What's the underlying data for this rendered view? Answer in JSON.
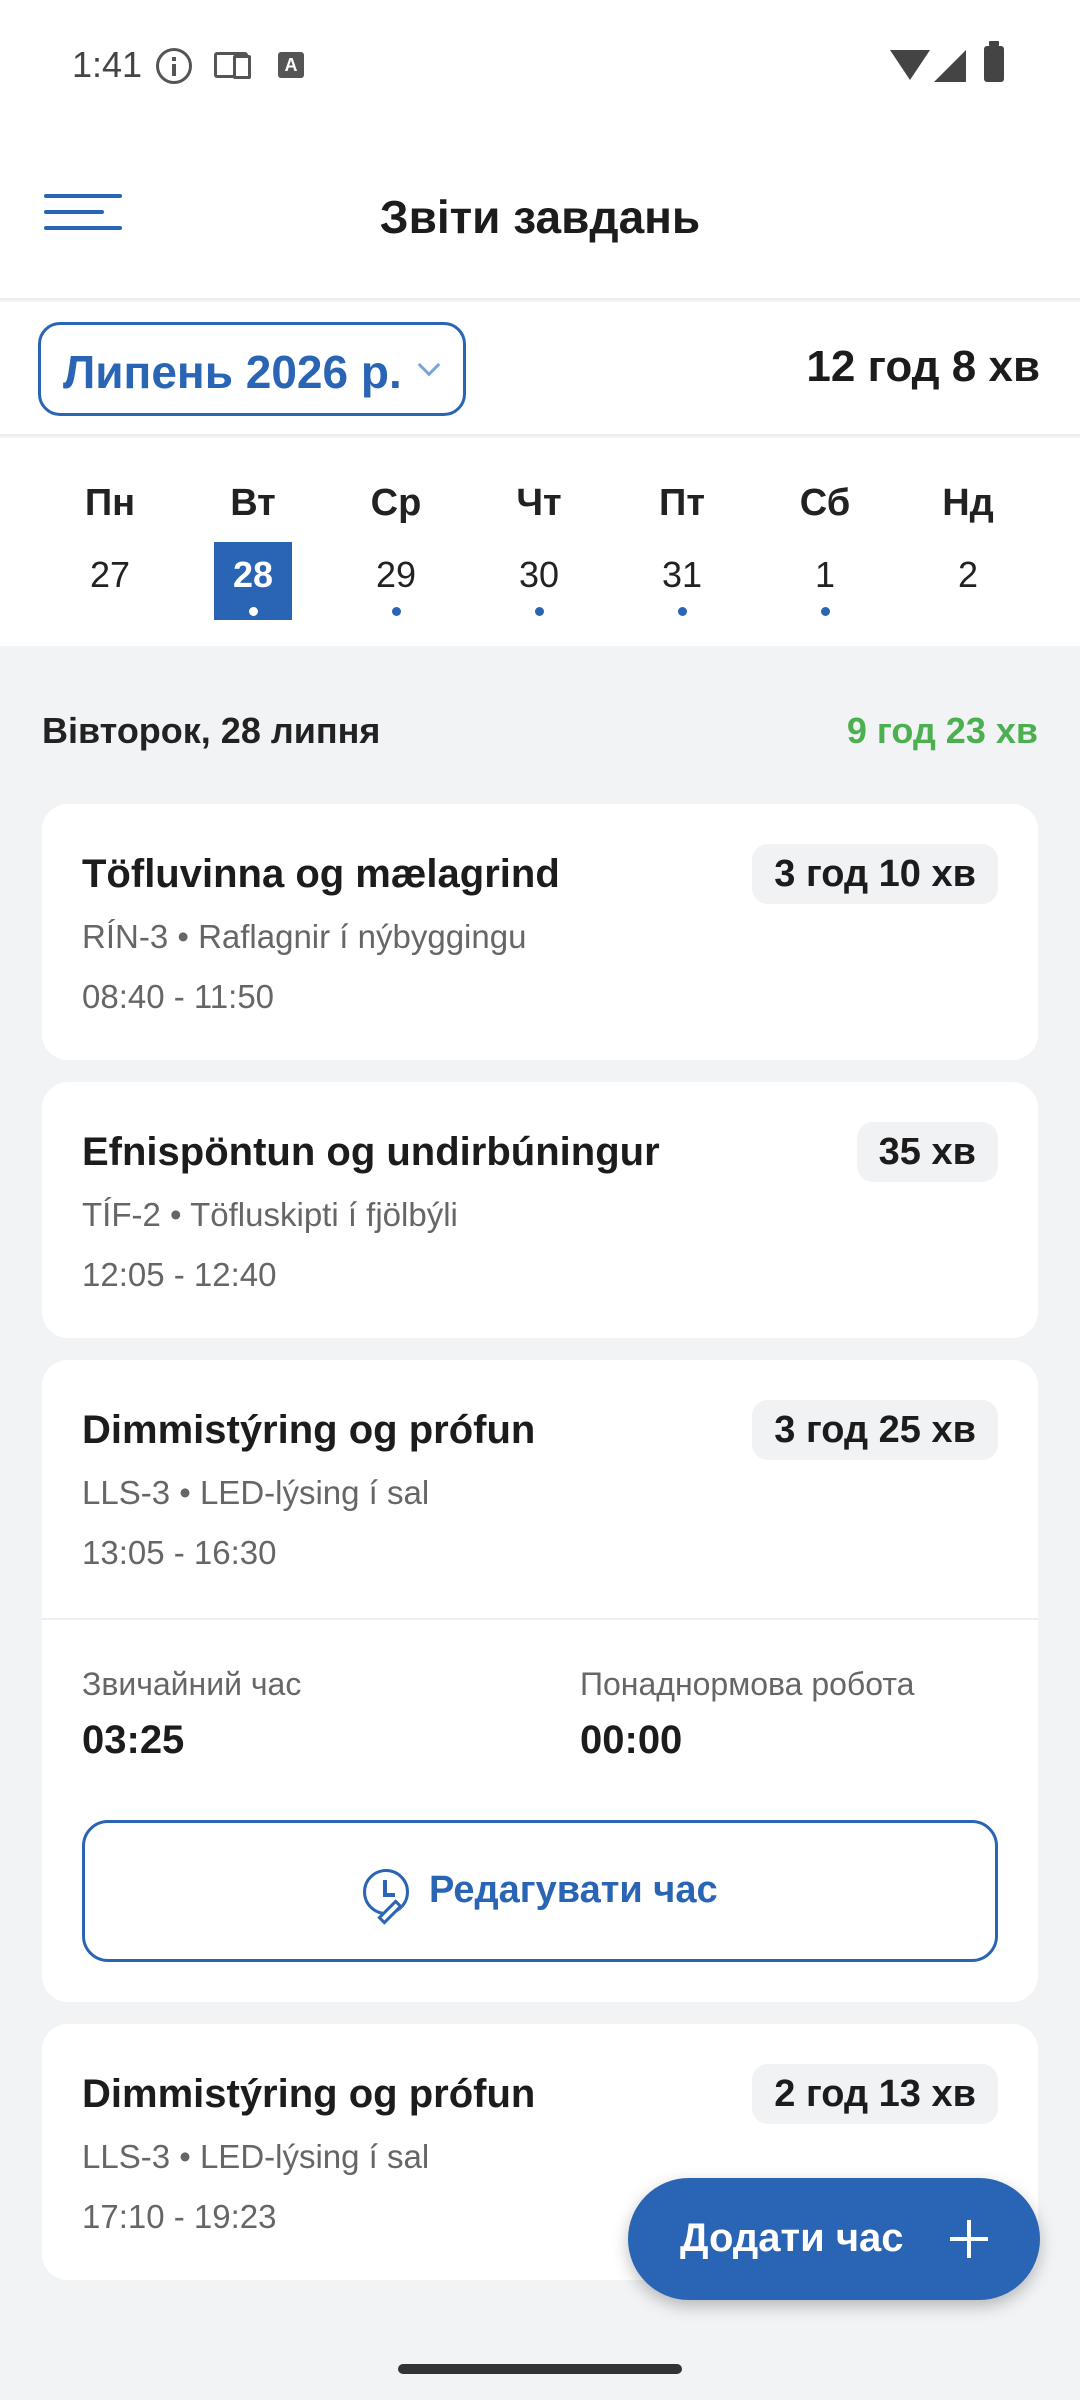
{
  "status_bar": {
    "time": "1:41"
  },
  "app_bar": {
    "title": "Звіти завдань"
  },
  "month_row": {
    "month_label": "Липень 2026 р.",
    "total": "12 год 8 хв"
  },
  "week": [
    {
      "name": "Пн",
      "num": "27",
      "selected": false,
      "has_entries": false
    },
    {
      "name": "Вт",
      "num": "28",
      "selected": true,
      "has_entries": true
    },
    {
      "name": "Ср",
      "num": "29",
      "selected": false,
      "has_entries": true
    },
    {
      "name": "Чт",
      "num": "30",
      "selected": false,
      "has_entries": true
    },
    {
      "name": "Пт",
      "num": "31",
      "selected": false,
      "has_entries": true
    },
    {
      "name": "Сб",
      "num": "1",
      "selected": false,
      "has_entries": true
    },
    {
      "name": "Нд",
      "num": "2",
      "selected": false,
      "has_entries": false
    }
  ],
  "day_header": {
    "date": "Вівторок, 28 липня",
    "total": "9 год 23 хв"
  },
  "entries": [
    {
      "title": "Töfluvinna og mælagrind",
      "duration": "3 год 10 хв",
      "subtitle": "RÍN-3 • Raflagnir í nýbyggingu",
      "time": "08:40 - 11:50"
    },
    {
      "title": "Efnispöntun og undirbúningur",
      "duration": "35 хв",
      "subtitle": "TÍF-2 • Töfluskipti í fjölbýli",
      "time": "12:05 - 12:40"
    },
    {
      "title": "Dimmistýring og prófun",
      "duration": "3 год 25 хв",
      "subtitle": "LLS-3 • LED-lýsing í sal",
      "time": "13:05 - 16:30",
      "expanded": {
        "regular_label": "Звичайний час",
        "regular_value": "03:25",
        "overtime_label": "Понаднормова робота",
        "overtime_value": "00:00",
        "edit_button": "Редагувати час"
      }
    },
    {
      "title": "Dimmistýring og prófun",
      "duration": "2 год 13 хв",
      "subtitle": "LLS-3 • LED-lýsing í sal",
      "time": "17:10 - 19:23"
    }
  ],
  "fab": {
    "label": "Додати час"
  },
  "colors": {
    "accent": "#2a64b4",
    "positive": "#4caf50",
    "background": "#f2f3f5"
  }
}
